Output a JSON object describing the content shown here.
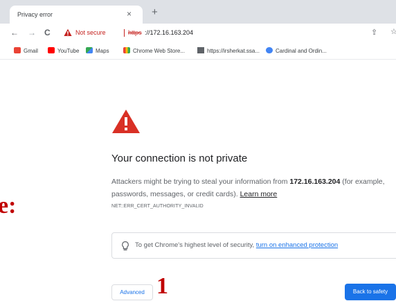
{
  "tab": {
    "title": "Privacy error",
    "close": "×",
    "new_tab": "+"
  },
  "toolbar": {
    "back": "←",
    "forward": "→",
    "reload": "C",
    "security_label": "Not secure",
    "url_scheme": "https",
    "url_host": "://172.16.163.204",
    "share": "⇪",
    "star": "☆"
  },
  "bookmarks": [
    {
      "label": "Gmail",
      "icon": "gmail-icon",
      "color": "#ea4335"
    },
    {
      "label": "YouTube",
      "icon": "youtube-icon",
      "color": "#ff0000"
    },
    {
      "label": "Maps",
      "icon": "maps-icon",
      "color": "#34a853"
    },
    {
      "label": "Chrome Web Store...",
      "icon": "chrome-web-store-icon",
      "color": "#fbbc04"
    },
    {
      "label": "https://irsherkat.ssa...",
      "icon": "site-icon",
      "color": "#5f6368"
    },
    {
      "label": "Cardinal and Ordin...",
      "icon": "cardinal-icon",
      "color": "#4285f4"
    }
  ],
  "interstitial": {
    "heading": "Your connection is not private",
    "body_pre": "Attackers might be trying to steal your information from ",
    "body_host": "172.16.163.204",
    "body_post": " (for example, passwords, messages, or credit cards). ",
    "learn_more": "Learn more",
    "error_code": "NET::ERR_CERT_AUTHORITY_INVALID",
    "promo_text": "To get Chrome's highest level of security, ",
    "promo_link": "turn on enhanced protection",
    "advanced": "Advanced",
    "back_to_safety": "Back to safety"
  },
  "annotations": {
    "step_number": "1",
    "left_fragment": "e:"
  },
  "colors": {
    "warning_red": "#d93025",
    "primary_blue": "#1a73e8",
    "annotation_red": "#c00000"
  }
}
